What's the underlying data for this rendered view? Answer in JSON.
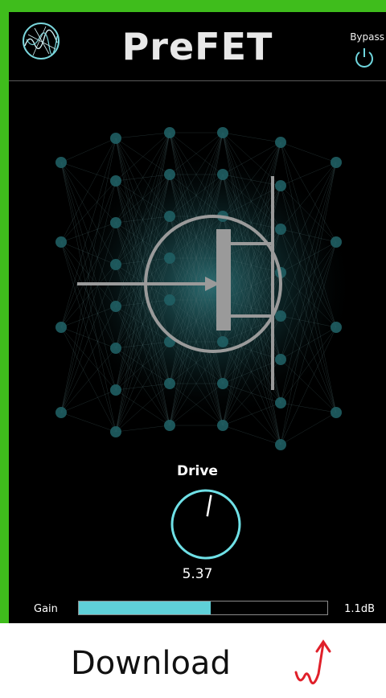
{
  "header": {
    "title": "PreFET",
    "bypass_label": "Bypass"
  },
  "icons": {
    "logo": "waveform-globe-logo",
    "bypass": "power-icon",
    "transistor": "fet-transistor-icon"
  },
  "drive": {
    "label": "Drive",
    "value_text": "5.37",
    "value": 5.37,
    "min": 0,
    "max": 10
  },
  "gain": {
    "label": "Gain",
    "value_text": "1.1dB",
    "fill_fraction": 0.53
  },
  "footer": {
    "download_label": "Download"
  },
  "colors": {
    "frame": "#3fbd1c",
    "panel": "#000000",
    "accent": "#5fd0d8",
    "annotation": "#e0202a"
  }
}
